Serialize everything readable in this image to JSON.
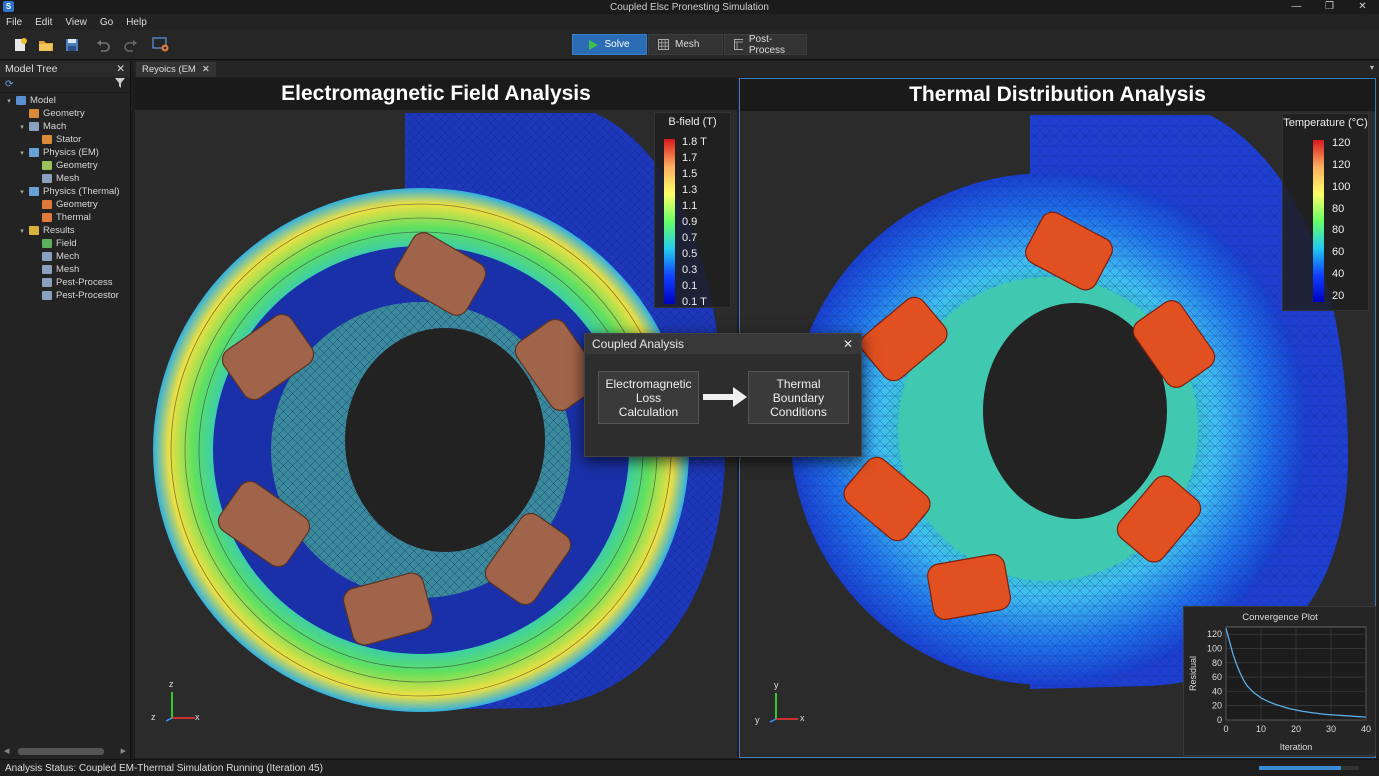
{
  "window": {
    "title": "Coupled Elsc Pronesting Simulation",
    "app_icon": "S"
  },
  "menu": [
    "File",
    "Edit",
    "View",
    "Go",
    "Help"
  ],
  "modes": {
    "solve": "Solve",
    "mesh": "Mesh",
    "post": "Post-Process"
  },
  "tree": {
    "title": "Model Tree",
    "nodes": [
      {
        "label": "Model",
        "level": 0,
        "toggle": "▾",
        "icon": "model-icon",
        "color": "#5b8fd4"
      },
      {
        "label": "Geometry",
        "level": 1,
        "toggle": "",
        "icon": "geometry-icon",
        "color": "#d98b3a"
      },
      {
        "label": "Mach",
        "level": 1,
        "toggle": "▾",
        "icon": "mach-icon",
        "color": "#8aa0c0"
      },
      {
        "label": "Stator",
        "level": 2,
        "toggle": "",
        "icon": "stator-icon",
        "color": "#d98b3a"
      },
      {
        "label": "Physics (EM)",
        "level": 1,
        "toggle": "▾",
        "icon": "physics-em-icon",
        "color": "#6aa0d8"
      },
      {
        "label": "Geometry",
        "level": 2,
        "toggle": "",
        "icon": "geometry-icon",
        "color": "#9ac05a"
      },
      {
        "label": "Mesh",
        "level": 2,
        "toggle": "",
        "icon": "mesh-icon",
        "color": "#8aa0c0"
      },
      {
        "label": "Physics (Thermal)",
        "level": 1,
        "toggle": "▾",
        "icon": "physics-thermal-icon",
        "color": "#6aa0d8"
      },
      {
        "label": "Geometry",
        "level": 2,
        "toggle": "",
        "icon": "geometry-icon",
        "color": "#e07a3a"
      },
      {
        "label": "Thermal",
        "level": 2,
        "toggle": "",
        "icon": "thermal-icon",
        "color": "#e07a3a"
      },
      {
        "label": "Results",
        "level": 1,
        "toggle": "▾",
        "icon": "results-icon",
        "color": "#d9b03a"
      },
      {
        "label": "Field",
        "level": 2,
        "toggle": "",
        "icon": "field-icon",
        "color": "#5bb05b"
      },
      {
        "label": "Mech",
        "level": 2,
        "toggle": "",
        "icon": "mech-icon",
        "color": "#8aa0c0"
      },
      {
        "label": "Mesh",
        "level": 2,
        "toggle": "",
        "icon": "mesh-icon",
        "color": "#8aa0c0"
      },
      {
        "label": "Pest-Process",
        "level": 2,
        "toggle": "",
        "icon": "post-process-icon",
        "color": "#8aa0c0"
      },
      {
        "label": "Pest-Procestor",
        "level": 2,
        "toggle": "",
        "icon": "post-processor-icon",
        "color": "#8aa0c0"
      }
    ]
  },
  "doc_tab": "Reyoics (EM",
  "em": {
    "title": "Electromagnetic Field Analysis",
    "legend_title": "B-field (T)",
    "legend_labels": [
      "1.8 T",
      "1.7",
      "1.5",
      "1.3",
      "1.1",
      "0.9",
      "0.7",
      "0.5",
      "0.3",
      "0.1",
      "0.1 T"
    ],
    "axes": {
      "z": "z",
      "zl": "z",
      "x": "x"
    }
  },
  "thermal": {
    "title": "Thermal Distribution Analysis",
    "legend_title": "Temperature (°C)",
    "legend_labels": [
      "120",
      "120",
      "100",
      "80",
      "80",
      "60",
      "40",
      "20"
    ],
    "axes": {
      "y": "y",
      "yl": "y",
      "x": "x"
    }
  },
  "dialog": {
    "title": "Coupled Analysis",
    "left": "Electromagnetic\nLoss\nCalculation",
    "right": "Thermal\nBoundary\nConditions"
  },
  "chart_data": {
    "type": "line",
    "title": "Convergence Plot",
    "xlabel": "Iteration",
    "ylabel": "Residual",
    "xlim": [
      0,
      40
    ],
    "ylim": [
      0,
      130
    ],
    "xticks": [
      0,
      10,
      20,
      30,
      40
    ],
    "yticks": [
      0,
      20,
      40,
      60,
      80,
      100,
      120
    ],
    "grid": true,
    "series": [
      {
        "x": [
          0,
          1,
          2,
          3,
          4,
          5,
          6,
          8,
          10,
          12,
          14,
          16,
          18,
          20,
          22,
          25,
          28,
          31,
          34,
          37,
          40
        ],
        "values": [
          128,
          110,
          92,
          78,
          66,
          56,
          48,
          38,
          31,
          26,
          22,
          19,
          16,
          14,
          12,
          10,
          8,
          7,
          6,
          5,
          4
        ]
      }
    ]
  },
  "status": {
    "text": "Analysis Status: Coupled EM-Thermal Simulation Running (Iteration 45)",
    "progress": 0.82
  }
}
